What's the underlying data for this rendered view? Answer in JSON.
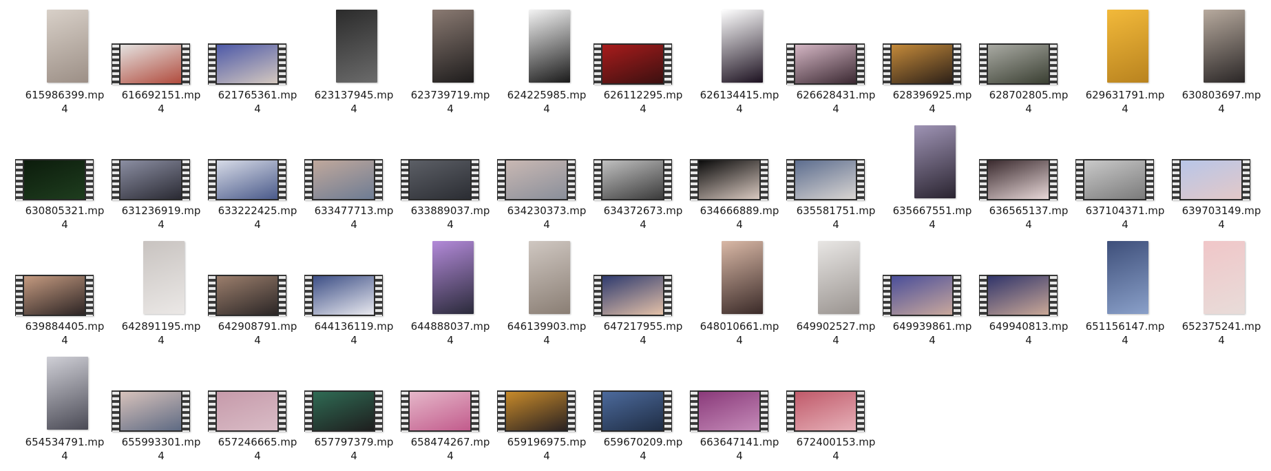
{
  "files": [
    {
      "name": "615986399.mp4",
      "kind": "portrait",
      "colors": [
        "#d8d0c8",
        "#9c8f86"
      ]
    },
    {
      "name": "616692151.mp4",
      "kind": "film",
      "colors": [
        "#e4e2e0",
        "#b14b3d"
      ]
    },
    {
      "name": "621765361.mp4",
      "kind": "film",
      "colors": [
        "#4d59a8",
        "#d4c8bf"
      ]
    },
    {
      "name": "623137945.mp4",
      "kind": "portrait",
      "colors": [
        "#2b2b2b",
        "#6b6b6b"
      ]
    },
    {
      "name": "623739719.mp4",
      "kind": "portrait",
      "colors": [
        "#8a7a72",
        "#1e1c1c"
      ]
    },
    {
      "name": "624225985.mp4",
      "kind": "portrait",
      "colors": [
        "#f3f3f3",
        "#1a1a1a"
      ]
    },
    {
      "name": "626112295.mp4",
      "kind": "film",
      "colors": [
        "#a81c1c",
        "#3b1010"
      ]
    },
    {
      "name": "626134415.mp4",
      "kind": "portrait",
      "colors": [
        "#ffffff",
        "#1c1120"
      ]
    },
    {
      "name": "626628431.mp4",
      "kind": "film",
      "colors": [
        "#d4b6c4",
        "#3a2831"
      ]
    },
    {
      "name": "628396925.mp4",
      "kind": "film",
      "colors": [
        "#c48a3a",
        "#2c2018"
      ]
    },
    {
      "name": "628702805.mp4",
      "kind": "film",
      "colors": [
        "#a9aaa3",
        "#3a3f32"
      ]
    },
    {
      "name": "629631791.mp4",
      "kind": "portrait",
      "colors": [
        "#f2b93a",
        "#b9831f"
      ]
    },
    {
      "name": "630803697.mp4",
      "kind": "portrait",
      "colors": [
        "#b7aa9e",
        "#2a2626"
      ]
    },
    {
      "name": "630805321.mp4",
      "kind": "film",
      "colors": [
        "#0c1c0c",
        "#1e3d1e"
      ]
    },
    {
      "name": "631236919.mp4",
      "kind": "film",
      "colors": [
        "#8b8ea2",
        "#2a2a33"
      ]
    },
    {
      "name": "633222425.mp4",
      "kind": "film",
      "colors": [
        "#d7dbe7",
        "#4a5a8a"
      ]
    },
    {
      "name": "633477713.mp4",
      "kind": "film",
      "colors": [
        "#c0a89c",
        "#6e7c93"
      ]
    },
    {
      "name": "633889037.mp4",
      "kind": "film",
      "colors": [
        "#5c5f66",
        "#2b2d33"
      ]
    },
    {
      "name": "634230373.mp4",
      "kind": "film",
      "colors": [
        "#c9b8b3",
        "#8a8f9a"
      ]
    },
    {
      "name": "634372673.mp4",
      "kind": "film",
      "colors": [
        "#c0c0c0",
        "#3b3b3b"
      ]
    },
    {
      "name": "634666889.mp4",
      "kind": "film",
      "colors": [
        "#0b0b0b",
        "#d9c9c0"
      ]
    },
    {
      "name": "635581751.mp4",
      "kind": "film",
      "colors": [
        "#5c6d8f",
        "#d9d5d2"
      ]
    },
    {
      "name": "635667551.mp4",
      "kind": "portrait",
      "colors": [
        "#9e93b4",
        "#2a2430"
      ]
    },
    {
      "name": "636565137.mp4",
      "kind": "film",
      "colors": [
        "#3a2a2e",
        "#e8d8d8"
      ]
    },
    {
      "name": "637104371.mp4",
      "kind": "film",
      "colors": [
        "#c9c9c9",
        "#7b7b7b"
      ]
    },
    {
      "name": "639703149.mp4",
      "kind": "film",
      "colors": [
        "#b8c6e8",
        "#e3c8c8"
      ]
    },
    {
      "name": "639884405.mp4",
      "kind": "film",
      "colors": [
        "#c49a80",
        "#2c2424"
      ]
    },
    {
      "name": "642891195.mp4",
      "kind": "portrait",
      "colors": [
        "#c8c3c0",
        "#ebe8e6"
      ]
    },
    {
      "name": "642908791.mp4",
      "kind": "film",
      "colors": [
        "#9b7e6c",
        "#2b2626"
      ]
    },
    {
      "name": "644136119.mp4",
      "kind": "film",
      "colors": [
        "#3d4f86",
        "#e9e9ef"
      ]
    },
    {
      "name": "644888037.mp4",
      "kind": "portrait",
      "colors": [
        "#b38ad9",
        "#2a2a3a"
      ]
    },
    {
      "name": "646139903.mp4",
      "kind": "portrait",
      "colors": [
        "#cfc7c1",
        "#8a7e74"
      ]
    },
    {
      "name": "647217955.mp4",
      "kind": "film",
      "colors": [
        "#2e3a6e",
        "#e4c1a8"
      ]
    },
    {
      "name": "648010661.mp4",
      "kind": "portrait",
      "colors": [
        "#d9b8a6",
        "#3a2a28"
      ]
    },
    {
      "name": "649902527.mp4",
      "kind": "portrait",
      "colors": [
        "#e8e6e4",
        "#9a9490"
      ]
    },
    {
      "name": "649939861.mp4",
      "kind": "film",
      "colors": [
        "#4a4e9a",
        "#c9a89c"
      ]
    },
    {
      "name": "649940813.mp4",
      "kind": "film",
      "colors": [
        "#30346a",
        "#caa897"
      ]
    },
    {
      "name": "651156147.mp4",
      "kind": "portrait",
      "colors": [
        "#3e4f7a",
        "#8aa0c9"
      ]
    },
    {
      "name": "652375241.mp4",
      "kind": "portrait",
      "colors": [
        "#f0c6c8",
        "#e8dcd9"
      ]
    },
    {
      "name": "654534791.mp4",
      "kind": "portrait",
      "colors": [
        "#cfcfd6",
        "#4a4a55"
      ]
    },
    {
      "name": "655993301.mp4",
      "kind": "film",
      "colors": [
        "#d7c2bb",
        "#5e6a83"
      ]
    },
    {
      "name": "657246665.mp4",
      "kind": "film",
      "colors": [
        "#c69aaa",
        "#d9bcc6"
      ]
    },
    {
      "name": "657797379.mp4",
      "kind": "film",
      "colors": [
        "#2f6b54",
        "#1e1e1e"
      ]
    },
    {
      "name": "658474267.mp4",
      "kind": "film",
      "colors": [
        "#e5b7c9",
        "#c25b8c"
      ]
    },
    {
      "name": "659196975.mp4",
      "kind": "film",
      "colors": [
        "#c78a2a",
        "#2a2222"
      ]
    },
    {
      "name": "659670209.mp4",
      "kind": "film",
      "colors": [
        "#4c6a9c",
        "#1f2d44"
      ]
    },
    {
      "name": "663647141.mp4",
      "kind": "film",
      "colors": [
        "#8a3a7a",
        "#c48ab8"
      ]
    },
    {
      "name": "672400153.mp4",
      "kind": "film",
      "colors": [
        "#c05a6a",
        "#e6b0b8"
      ]
    }
  ]
}
